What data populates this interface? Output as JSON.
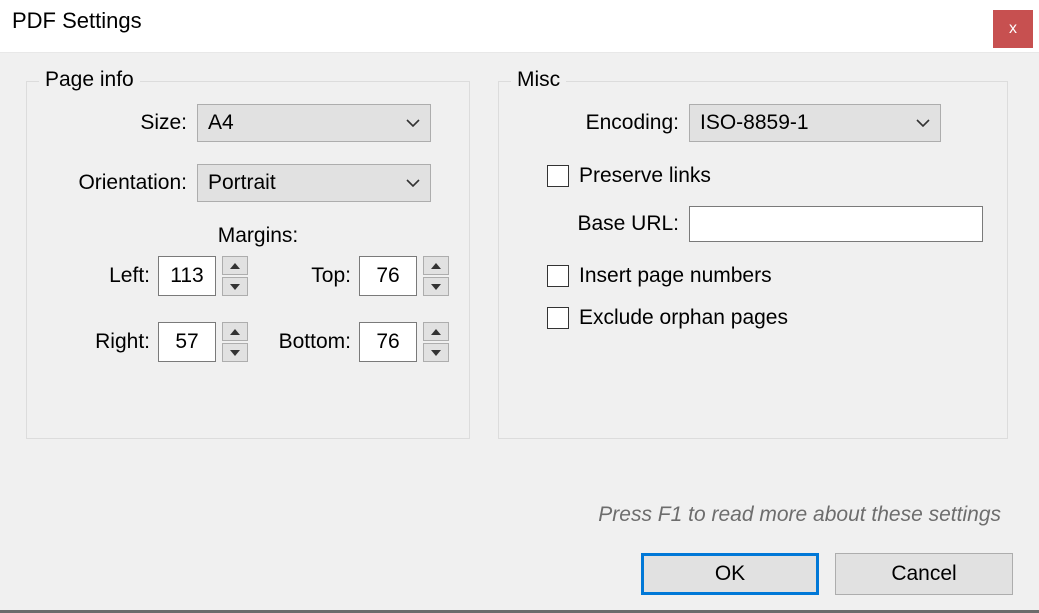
{
  "window": {
    "title": "PDF Settings",
    "close_icon": "x"
  },
  "page_info": {
    "legend": "Page info",
    "size_label": "Size:",
    "size_value": "A4",
    "orientation_label": "Orientation:",
    "orientation_value": "Portrait",
    "margins_label": "Margins:",
    "left_label": "Left:",
    "left_value": "113",
    "top_label": "Top:",
    "top_value": "76",
    "right_label": "Right:",
    "right_value": "57",
    "bottom_label": "Bottom:",
    "bottom_value": "76"
  },
  "misc": {
    "legend": "Misc",
    "encoding_label": "Encoding:",
    "encoding_value": "ISO-8859-1",
    "preserve_links_label": "Preserve links",
    "preserve_links_checked": false,
    "base_url_label": "Base URL:",
    "base_url_value": "",
    "insert_page_numbers_label": "Insert page numbers",
    "insert_page_numbers_checked": false,
    "exclude_orphan_label": "Exclude orphan pages",
    "exclude_orphan_checked": false
  },
  "hint": "Press F1 to read more about these settings",
  "buttons": {
    "ok": "OK",
    "cancel": "Cancel"
  }
}
